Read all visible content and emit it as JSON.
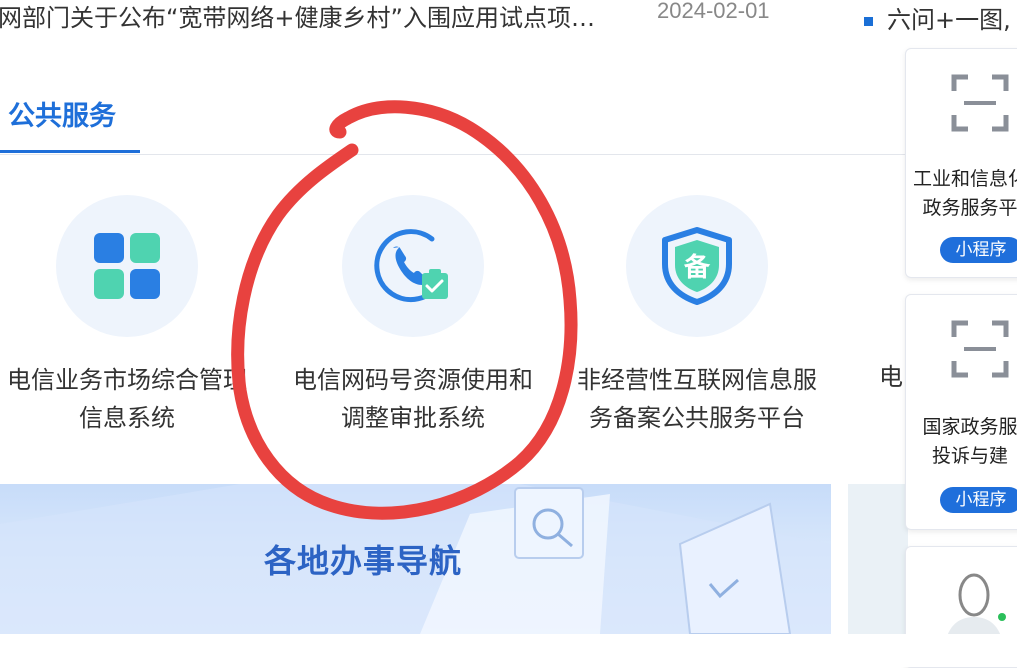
{
  "news": {
    "title": "网部门关于公布“宽带网络+健康乡村”入围应用试点项…",
    "date": "2024-02-01",
    "right_item": "六问+一图,"
  },
  "tabs": {
    "active": "公共服务"
  },
  "services": [
    {
      "line1": "电信业务市场综合管理",
      "line2": "信息系统",
      "icon": "grid-app-icon"
    },
    {
      "line1": "电信网码号资源使用和",
      "line2": "调整审批系统",
      "icon": "phone-approval-icon"
    },
    {
      "line1": "非经营性互联网信息服",
      "line2": "务备案公共服务平台",
      "icon": "filing-shield-icon"
    },
    {
      "line1": "电"
    }
  ],
  "banner": {
    "title": "各地办事导航"
  },
  "side_cards": [
    {
      "line1": "工业和信息化",
      "line2": "政务服务平",
      "badge": "小程序"
    },
    {
      "line1": "国家政务服",
      "line2": "投诉与建",
      "badge": "小程序"
    },
    {}
  ],
  "colors": {
    "accent": "#1e6fd9",
    "annotation": "#e8423f"
  }
}
